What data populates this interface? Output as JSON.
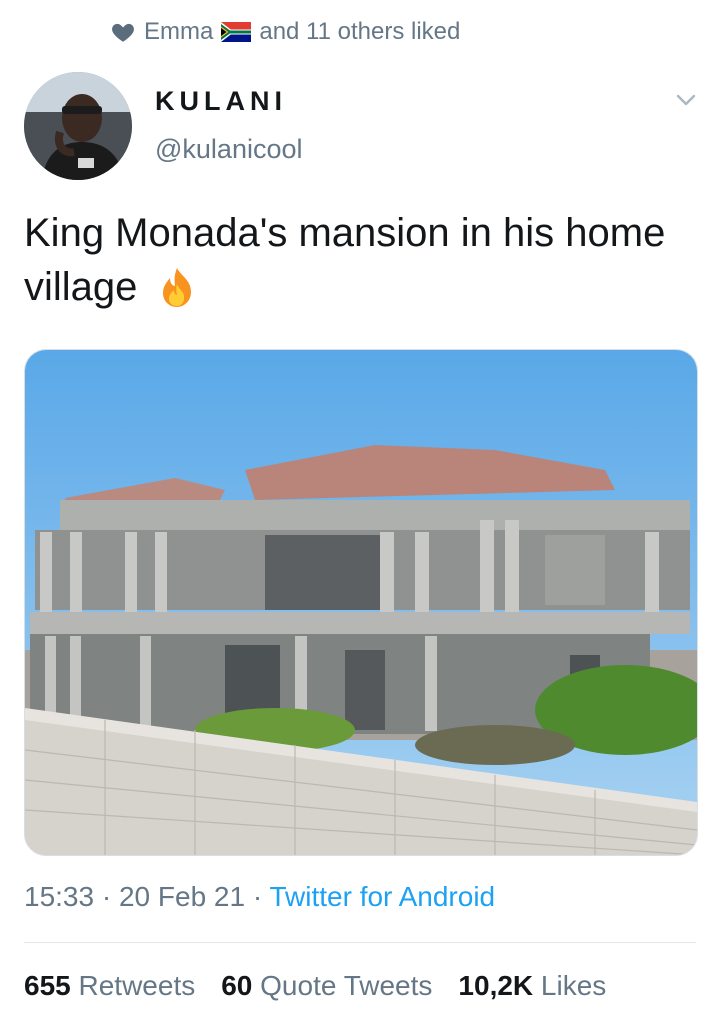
{
  "liked_by": {
    "name": "Emma",
    "rest": "and 11 others liked",
    "icon": "heart-icon",
    "flag": "south-africa-flag"
  },
  "author": {
    "display_name": "KULANI",
    "handle": "@kulanicool"
  },
  "tweet": {
    "text": "King Monada's mansion in his home village",
    "emoji": "fire-emoji"
  },
  "media": {
    "alt": "two-storey mansion under construction with columns and tiled roof behind a brick wall"
  },
  "meta": {
    "time": "15:33",
    "sep1": " · ",
    "date": "20 Feb 21",
    "sep2": " · ",
    "source": "Twitter for Android"
  },
  "stats": {
    "retweets_count": "655",
    "retweets_label": "Retweets",
    "quotes_count": "60",
    "quotes_label": "Quote Tweets",
    "likes_count": "10,2K",
    "likes_label": "Likes"
  },
  "colors": {
    "accent": "#1da1f2",
    "secondary_text": "#657786",
    "primary_text": "#14171a"
  }
}
